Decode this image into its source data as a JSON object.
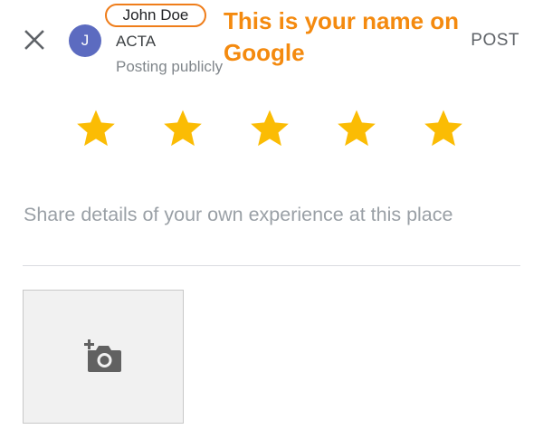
{
  "header": {
    "user_initial": "J",
    "user_name": "John Doe",
    "place_name": "ACTA",
    "posting_note": "Posting publicly",
    "post_label": "POST"
  },
  "annotation": {
    "text": "This is your name on Google",
    "color": "#f48a0f",
    "outline_color": "#ef7d1a"
  },
  "rating": {
    "value": 5,
    "max": 5,
    "star_color": "#fbbc04"
  },
  "review": {
    "placeholder": "Share details of your own experience at this place"
  },
  "photo": {
    "icon": "add-photo-camera-icon"
  },
  "colors": {
    "avatar": "#5c6bc0"
  }
}
